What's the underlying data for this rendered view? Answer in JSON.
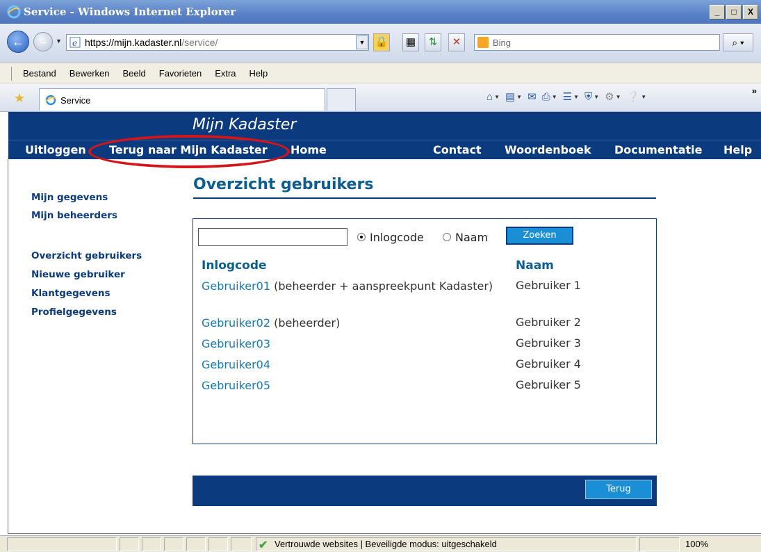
{
  "window": {
    "title": "Service - Windows Internet Explorer",
    "controls": [
      "_",
      "□",
      "X"
    ]
  },
  "addressbar": {
    "url_host": "https://mijn.kadaster.nl",
    "url_path": "/service/",
    "search_placeholder": "Bing",
    "search_button": "⌕"
  },
  "menubar": {
    "items": [
      "Bestand",
      "Bewerken",
      "Beeld",
      "Favorieten",
      "Extra",
      "Help"
    ]
  },
  "tabs": {
    "active_title": "Service"
  },
  "site": {
    "brand": "Mijn Kadaster",
    "nav": {
      "logout": "Uitloggen",
      "back_to_portal": "Terug naar Mijn Kadaster",
      "home": "Home",
      "contact": "Contact",
      "dictionary": "Woordenboek",
      "documentation": "Documentatie",
      "help": "Help"
    },
    "highlight_color": "#d4151a",
    "brand_color": "#0b3a7e"
  },
  "sidebar": {
    "items": [
      "Mijn gegevens",
      "Mijn beheerders",
      "Overzicht gebruikers",
      "Nieuwe gebruiker",
      "Klantgegevens",
      "Profielgegevens"
    ]
  },
  "main": {
    "title": "Overzicht gebruikers",
    "search": {
      "value": "",
      "radio_options": [
        "Inlogcode",
        "Naam"
      ],
      "selected": "Inlogcode",
      "button": "Zoeken"
    },
    "table": {
      "headers": [
        "Inlogcode",
        "Naam"
      ],
      "rows": [
        {
          "code": "Gebruiker01",
          "note": "(beheerder + aanspreekpunt Kadaster)",
          "name": "Gebruiker  1"
        },
        {
          "code": "Gebruiker02",
          "note": "(beheerder)",
          "name": "Gebruiker  2"
        },
        {
          "code": "Gebruiker03",
          "note": "",
          "name": "Gebruiker  3"
        },
        {
          "code": "Gebruiker04",
          "note": "",
          "name": "Gebruiker  4"
        },
        {
          "code": "Gebruiker05",
          "note": "",
          "name": "Gebruiker  5"
        }
      ]
    },
    "back_button": "Terug"
  },
  "statusbar": {
    "zone": "Vertrouwde websites | Beveiligde modus: uitgeschakeld",
    "zoom": "100%"
  }
}
